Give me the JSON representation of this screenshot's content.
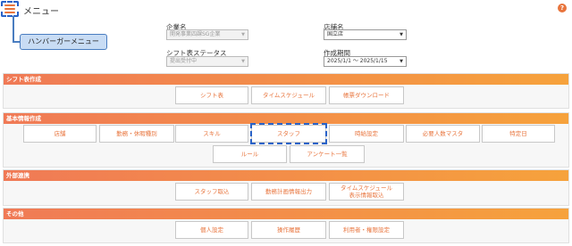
{
  "header": {
    "menu_title": "メニュー",
    "help_label": "?"
  },
  "callout": {
    "label": "ハンバーガーメニュー"
  },
  "filters": {
    "company_label": "企業名",
    "company_value": "開発事業四課SG企業",
    "store_label": "店舗名",
    "store_value": "国立店",
    "status_label": "シフト表ステータス",
    "status_value": "提出受付中",
    "period_label": "作成期間",
    "period_value": "2025/1/1 ～ 2025/1/15",
    "caret": "▼"
  },
  "sections": {
    "shift": {
      "title": "シフト表作成",
      "buttons": [
        "シフト表",
        "タイムスケジュール",
        "帳票ダウンロード"
      ]
    },
    "basic": {
      "title": "基本情報作成",
      "buttons": [
        "店舗",
        "勤務・休暇種別",
        "スキル",
        "スタッフ",
        "時給設定",
        "必要人数マスタ",
        "特定日",
        "ルール",
        "アンケート一覧"
      ]
    },
    "external": {
      "title": "外部連携",
      "buttons": [
        "スタッフ取込",
        "勤務計画情報出力",
        "タイムスケジュール\n表示情報取込"
      ]
    },
    "other": {
      "title": "その他",
      "buttons": [
        "個人設定",
        "操作履歴",
        "利用者・権限設定"
      ]
    }
  },
  "colors": {
    "accent": "#e8743c",
    "section_gradient_start": "#f07a56",
    "section_gradient_end": "#f6a23c",
    "highlight": "#2a63c8"
  }
}
